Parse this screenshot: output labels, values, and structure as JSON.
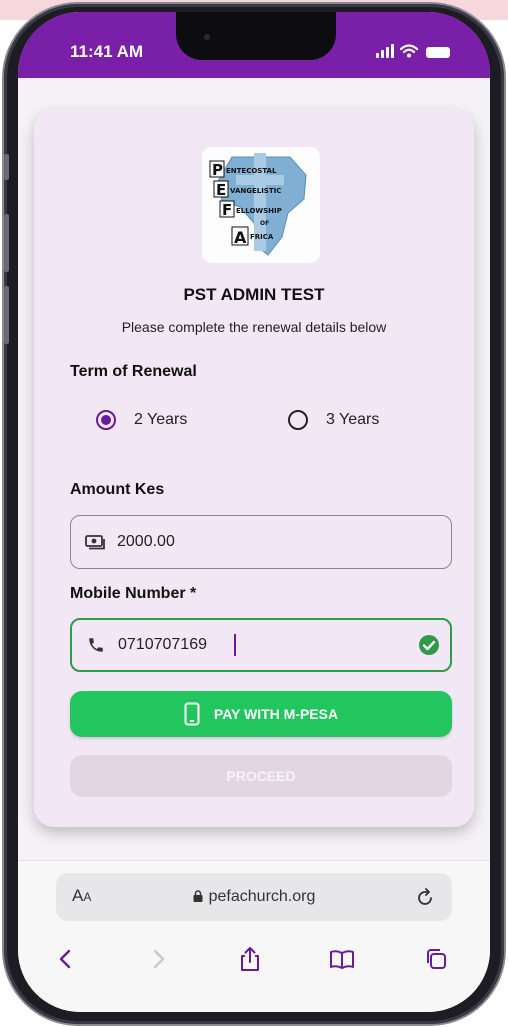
{
  "status_bar": {
    "time": "11:41 AM"
  },
  "card": {
    "logo": {
      "alt": "PEFA logo",
      "lines": [
        {
          "initial": "P",
          "rest": "ENTECOSTAL"
        },
        {
          "initial": "E",
          "rest": "VANGELISTIC"
        },
        {
          "initial": "F",
          "rest": "ELLOWSHIP"
        },
        {
          "initial": "",
          "rest": "OF"
        },
        {
          "initial": "A",
          "rest": "FRICA"
        }
      ]
    },
    "org_name": "PST ADMIN TEST",
    "subtitle": "Please complete the renewal details below",
    "term": {
      "label": "Term of Renewal",
      "options": [
        {
          "label": "2 Years",
          "selected": true
        },
        {
          "label": "3 Years",
          "selected": false
        }
      ]
    },
    "amount": {
      "label": "Amount Kes",
      "value": "2000.00",
      "icon": "cash-icon"
    },
    "mobile": {
      "label": "Mobile Number *",
      "value": "0710707169",
      "icon": "phone-icon",
      "valid": true
    },
    "pay_button": {
      "label": "PAY WITH M-PESA",
      "icon": "mobile-device-icon",
      "color": "#22c55e"
    },
    "proceed_button": {
      "label": "PROCEED",
      "enabled": false
    }
  },
  "browser": {
    "text_size": {
      "big": "A",
      "small": "A"
    },
    "url": "pefachurch.org",
    "nav": [
      "back-icon",
      "forward-icon",
      "share-icon",
      "bookmarks-icon",
      "tabs-icon"
    ]
  },
  "colors": {
    "status_bar": "#7a1fa8",
    "accent": "#6a1b9a",
    "card": "#f2e8f5",
    "success": "#2e9b48"
  }
}
